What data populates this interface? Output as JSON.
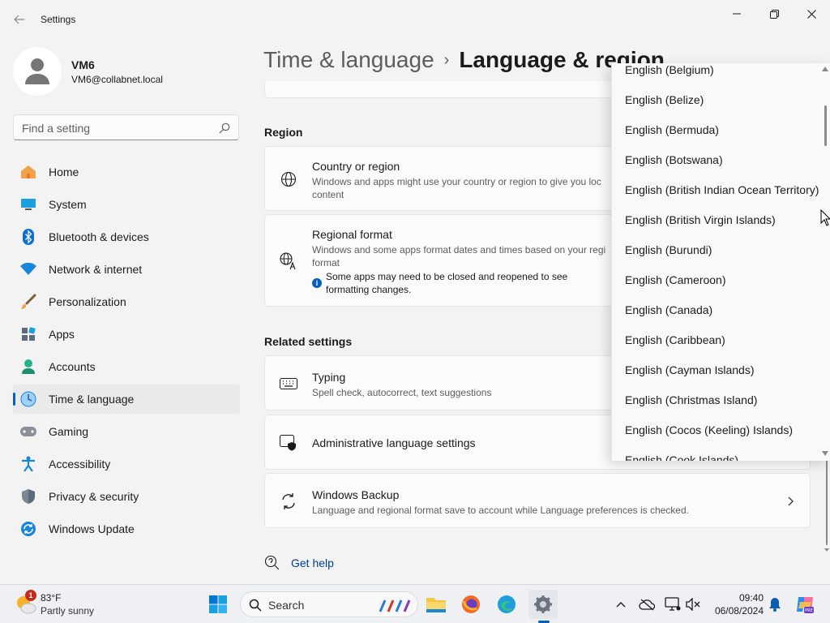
{
  "window": {
    "title": "Settings"
  },
  "user": {
    "name": "VM6",
    "email": "VM6@collabnet.local"
  },
  "search": {
    "placeholder": "Find a setting"
  },
  "nav": {
    "items": [
      {
        "label": "Home",
        "icon": "home-icon"
      },
      {
        "label": "System",
        "icon": "system-icon"
      },
      {
        "label": "Bluetooth & devices",
        "icon": "bluetooth-icon"
      },
      {
        "label": "Network & internet",
        "icon": "wifi-icon"
      },
      {
        "label": "Personalization",
        "icon": "brush-icon"
      },
      {
        "label": "Apps",
        "icon": "apps-icon"
      },
      {
        "label": "Accounts",
        "icon": "accounts-icon"
      },
      {
        "label": "Time & language",
        "icon": "time-language-icon",
        "active": true
      },
      {
        "label": "Gaming",
        "icon": "gamepad-icon"
      },
      {
        "label": "Accessibility",
        "icon": "accessibility-icon"
      },
      {
        "label": "Privacy & security",
        "icon": "shield-icon"
      },
      {
        "label": "Windows Update",
        "icon": "update-icon"
      }
    ]
  },
  "breadcrumb": {
    "parent": "Time & language",
    "separator": "›",
    "current": "Language & region"
  },
  "region": {
    "heading": "Region",
    "country": {
      "title": "Country or region",
      "desc_line1": "Windows and apps might use your country or region to give you loc",
      "desc_line2": "content"
    },
    "format": {
      "title": "Regional format",
      "desc_line1": "Windows and some apps format dates and times based on your regi",
      "desc_line2": "format",
      "note_line1": "Some apps may need to be closed and reopened to see",
      "note_line2": "formatting changes."
    }
  },
  "related": {
    "heading": "Related settings",
    "typing": {
      "title": "Typing",
      "desc": "Spell check, autocorrect, text suggestions"
    },
    "admin": {
      "title": "Administrative language settings"
    },
    "backup": {
      "title": "Windows Backup",
      "desc": "Language and regional format save to account while Language preferences is checked."
    }
  },
  "help": {
    "label": "Get help"
  },
  "dropdown": {
    "options": [
      "English (Belgium)",
      "English (Belize)",
      "English (Bermuda)",
      "English (Botswana)",
      "English (British Indian Ocean Territory)",
      "English (British Virgin Islands)",
      "English (Burundi)",
      "English (Cameroon)",
      "English (Canada)",
      "English (Caribbean)",
      "English (Cayman Islands)",
      "English (Christmas Island)",
      "English (Cocos (Keeling) Islands)",
      "English (Cook Islands)"
    ]
  },
  "taskbar": {
    "weather": {
      "temp": "83°F",
      "condition": "Partly sunny",
      "badge": "1"
    },
    "search_label": "Search",
    "clock": {
      "time": "09:40",
      "date": "06/08/2024"
    }
  },
  "colors": {
    "accent": "#005fb8",
    "background": "#f3f3f3",
    "card": "#fbfbfb"
  }
}
